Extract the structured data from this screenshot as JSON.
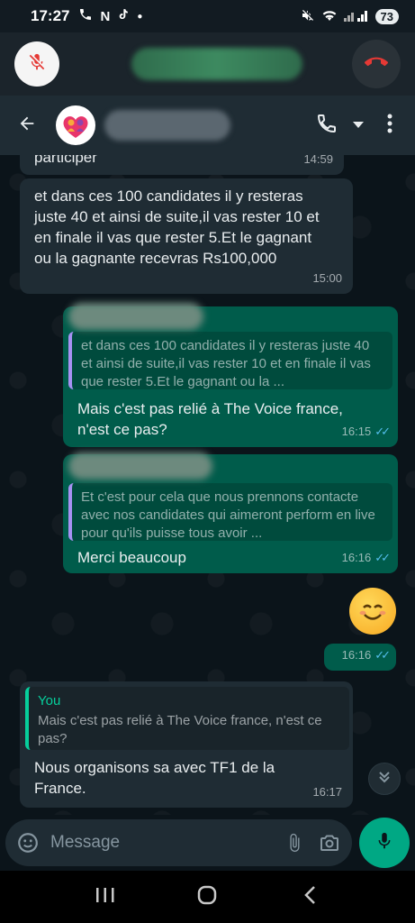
{
  "status_bar": {
    "time": "17:27",
    "battery": "73"
  },
  "chat_header": {},
  "messages": [
    {
      "id": "m1",
      "direction": "in",
      "text": "participer",
      "time": "14:59"
    },
    {
      "id": "m2",
      "direction": "in",
      "text": "et dans ces 100 candidates il y resteras juste 40 et ainsi de suite,il vas rester 10 et en finale il vas que rester 5.Et le gagnant ou la gagnante recevras Rs100,000",
      "time": "15:00"
    },
    {
      "id": "m3",
      "direction": "out",
      "quote_text": "et dans ces 100 candidates il y resteras juste 40 et ainsi de suite,il vas rester 10 et en finale il vas que rester 5.Et le gagnant ou la ...",
      "text": "Mais c'est pas relié à The Voice france, n'est ce pas?",
      "time": "16:15"
    },
    {
      "id": "m4",
      "direction": "out",
      "quote_text": "Et c'est pour cela que nous prennons contacte avec nos candidates qui aimeront perform en live pour qu'ils puisse tous avoir ...",
      "text": "Merci beaucoup",
      "time": "16:16"
    },
    {
      "id": "m5",
      "direction": "out",
      "emoji": "smiling-face-icon",
      "time": "16:16"
    },
    {
      "id": "m6",
      "direction": "in",
      "quote_author": "You",
      "quote_text": "Mais c'est pas relié à The Voice france, n'est ce pas?",
      "text": "Nous organisons sa avec TF1 de la France.",
      "time": "16:17"
    }
  ],
  "composer": {
    "placeholder": "Message"
  },
  "colors": {
    "accent": "#00a884",
    "outgoing_bubble": "#005c4b",
    "incoming_bubble": "#1f2c34",
    "read_ticks": "#53bdeb",
    "hangup": "#e53935"
  }
}
